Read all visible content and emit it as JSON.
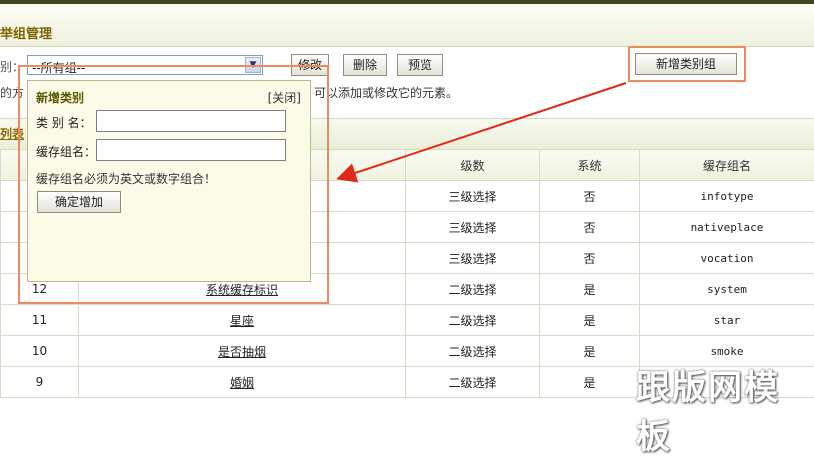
{
  "header": {
    "title": "举组管理"
  },
  "toolbar": {
    "group_label": "别：",
    "group_select": {
      "selected": "--所有组--"
    },
    "buttons": {
      "edit": "修改",
      "delete": "删除",
      "preview": "预览",
      "add_group": "新增类别组"
    },
    "hint_left": "的方",
    "hint_right": "可以添加或修改它的元素。"
  },
  "section": {
    "title": "列表"
  },
  "table": {
    "headers": [
      "",
      "",
      "级数",
      "系统",
      "缓存组名"
    ],
    "rows": [
      {
        "id": "",
        "name": "",
        "level": "三级选择",
        "system": "否",
        "cache": "infotype"
      },
      {
        "id": "",
        "name": "",
        "level": "三级选择",
        "system": "否",
        "cache": "nativeplace"
      },
      {
        "id": "",
        "name": "",
        "level": "三级选择",
        "system": "否",
        "cache": "vocation"
      },
      {
        "id": "12",
        "name": "系统缓存标识",
        "level": "二级选择",
        "system": "是",
        "cache": "system"
      },
      {
        "id": "11",
        "name": "星座",
        "level": "二级选择",
        "system": "是",
        "cache": "star"
      },
      {
        "id": "10",
        "name": "是否抽烟",
        "level": "二级选择",
        "system": "是",
        "cache": "smoke"
      },
      {
        "id": "9",
        "name": "婚姻",
        "level": "二级选择",
        "system": "是",
        "cache": ""
      }
    ]
  },
  "popup": {
    "title": "新增类别",
    "close": "[关闭]",
    "label_name": "类 别 名：",
    "label_cache": "缓存组名：",
    "name_value": "",
    "cache_value": "",
    "note": "缓存组名必须为英文或数字组合！",
    "submit": "确定增加"
  },
  "watermark": "跟版网模板",
  "colors": {
    "annotation": "#ee8a60",
    "arrow": "#dd2a1a",
    "title": "#7d6400"
  }
}
